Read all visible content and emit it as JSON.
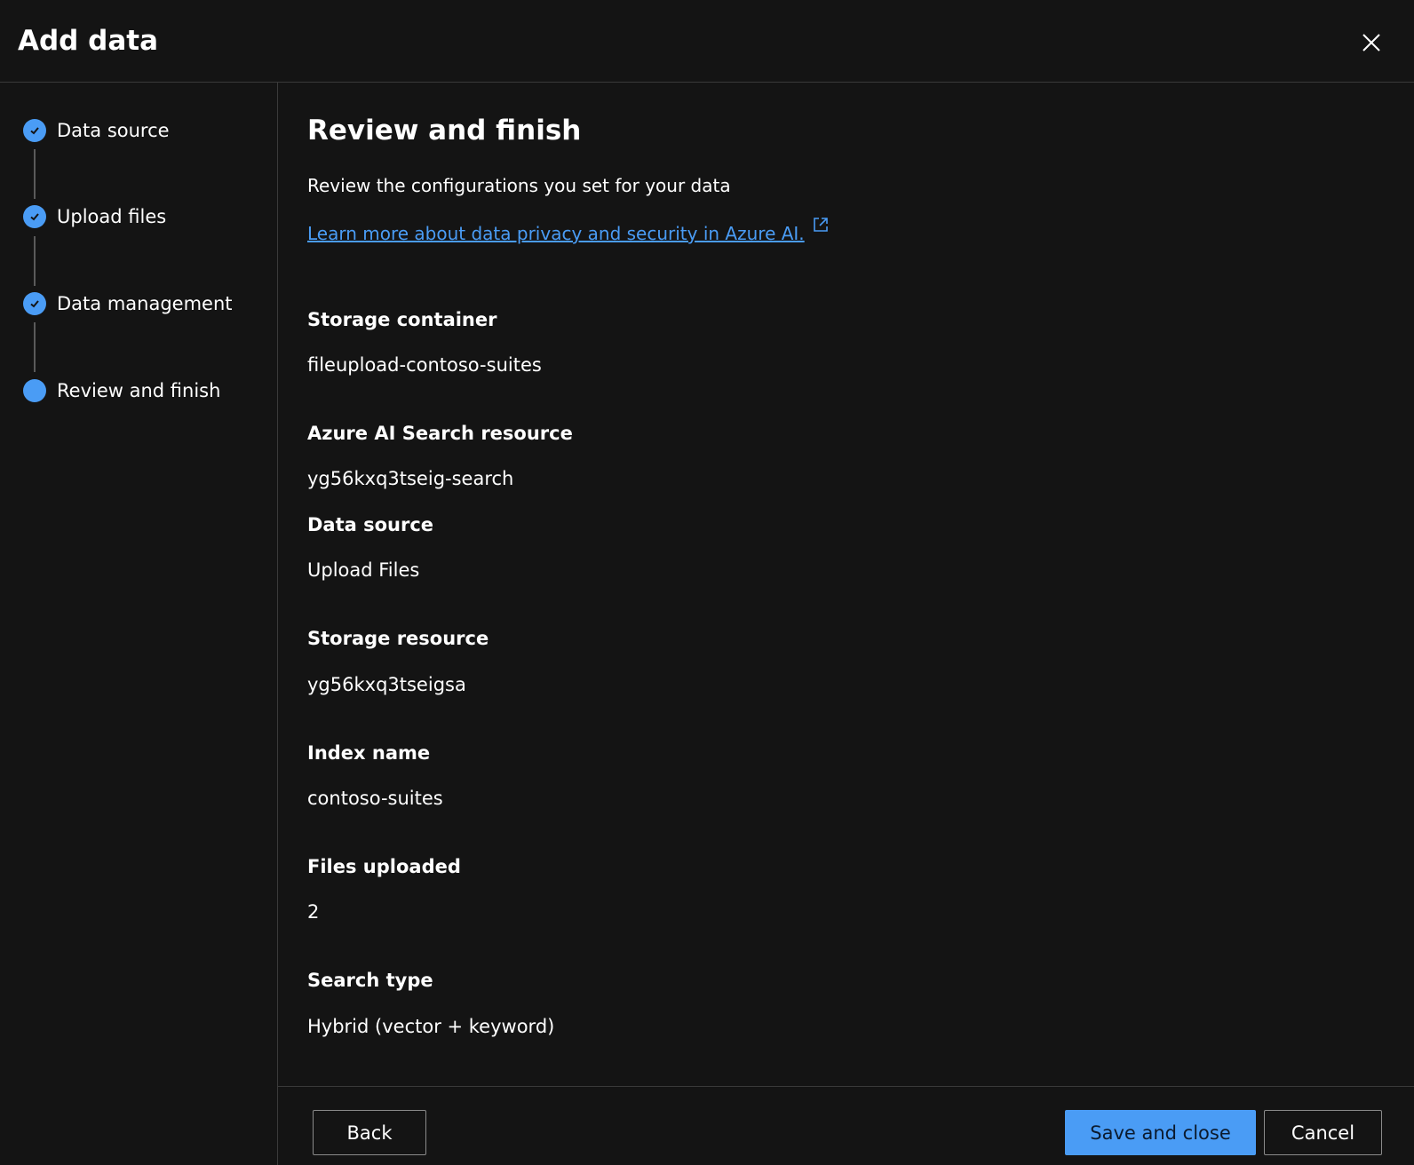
{
  "dialog": {
    "title": "Add data",
    "close_icon": "close-icon"
  },
  "steps": [
    {
      "label": "Data source",
      "state": "completed"
    },
    {
      "label": "Upload files",
      "state": "completed"
    },
    {
      "label": "Data management",
      "state": "completed"
    },
    {
      "label": "Review and finish",
      "state": "current"
    }
  ],
  "main": {
    "title": "Review and finish",
    "intro": "Review the configurations you set for your data",
    "link_text": "Learn more about data privacy and security in Azure AI.",
    "fields": [
      {
        "label": "Storage container",
        "value": "fileupload-contoso-suites"
      },
      {
        "label": "Azure AI Search resource",
        "value": "yg56kxq3tseig-search"
      },
      {
        "label": "Data source",
        "value": "Upload Files"
      },
      {
        "label": "Storage resource",
        "value": "yg56kxq3tseigsa"
      },
      {
        "label": "Index name",
        "value": "contoso-suites"
      },
      {
        "label": "Files uploaded",
        "value": "2"
      },
      {
        "label": "Search type",
        "value": "Hybrid (vector + keyword)"
      }
    ]
  },
  "footer": {
    "back_label": "Back",
    "save_label": "Save and close",
    "cancel_label": "Cancel"
  },
  "colors": {
    "background": "#141414",
    "accent": "#4a9cf5",
    "divider": "#3a3a3a",
    "text": "#ffffff"
  }
}
